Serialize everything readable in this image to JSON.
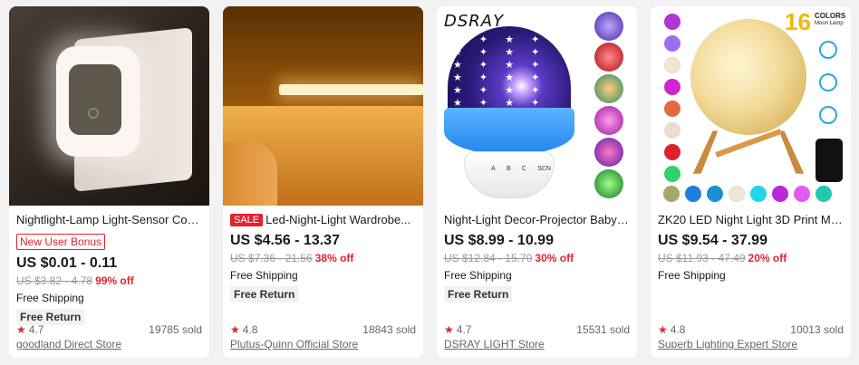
{
  "products": [
    {
      "title": "Nightlight-Lamp Light-Sensor Control...",
      "bonus": "New User Bonus",
      "price": "US $0.01 - 0.11",
      "original_price": "US $3.82 - 4.78",
      "discount": "99% off",
      "shipping": "Free Shipping",
      "returns": "Free Return",
      "rating": "4.7",
      "sold": "19785 sold",
      "store": "goodland Direct Store"
    },
    {
      "sale_tag": "SALE",
      "title": "Led-Night-Light Wardrobe...",
      "price": "US $4.56 - 13.37",
      "original_price": "US $7.36 - 21.56",
      "discount": "38% off",
      "shipping": "Free Shipping",
      "returns": "Free Return",
      "rating": "4.8",
      "sold": "18843 sold",
      "store": "Plutus-Quinn Official Store"
    },
    {
      "title": "Night-Light Decor-Projector Baby-Lamp...",
      "price": "US $8.99 - 10.99",
      "original_price": "US $12.84 - 15.70",
      "discount": "30% off",
      "shipping": "Free Shipping",
      "returns": "Free Return",
      "rating": "4.7",
      "sold": "15531 sold",
      "store": "DSRAY LIGHT Store",
      "image_brand": "DSRAY",
      "image_buttons": [
        "A",
        "B",
        "C",
        "SCN"
      ]
    },
    {
      "title": "ZK20 LED Night Light 3D Print Moon Lamp...",
      "price": "US $9.54 - 37.99",
      "original_price": "US $11.93 - 47.49",
      "discount": "20% off",
      "shipping": "Free Shipping",
      "rating": "4.8",
      "sold": "10013 sold",
      "store": "Superb Lighting Expert Store",
      "image_count": "16",
      "image_caption": "COLORS",
      "image_subcaption": "Moon Lamp",
      "image_icons": [
        "Remote Control",
        "Charging",
        "Touch"
      ]
    }
  ],
  "icons": {
    "rating": "star-icon"
  },
  "colors": {
    "accent": "#e5212e",
    "text": "#191919",
    "muted": "#999999",
    "background": "#f2f2f2"
  }
}
